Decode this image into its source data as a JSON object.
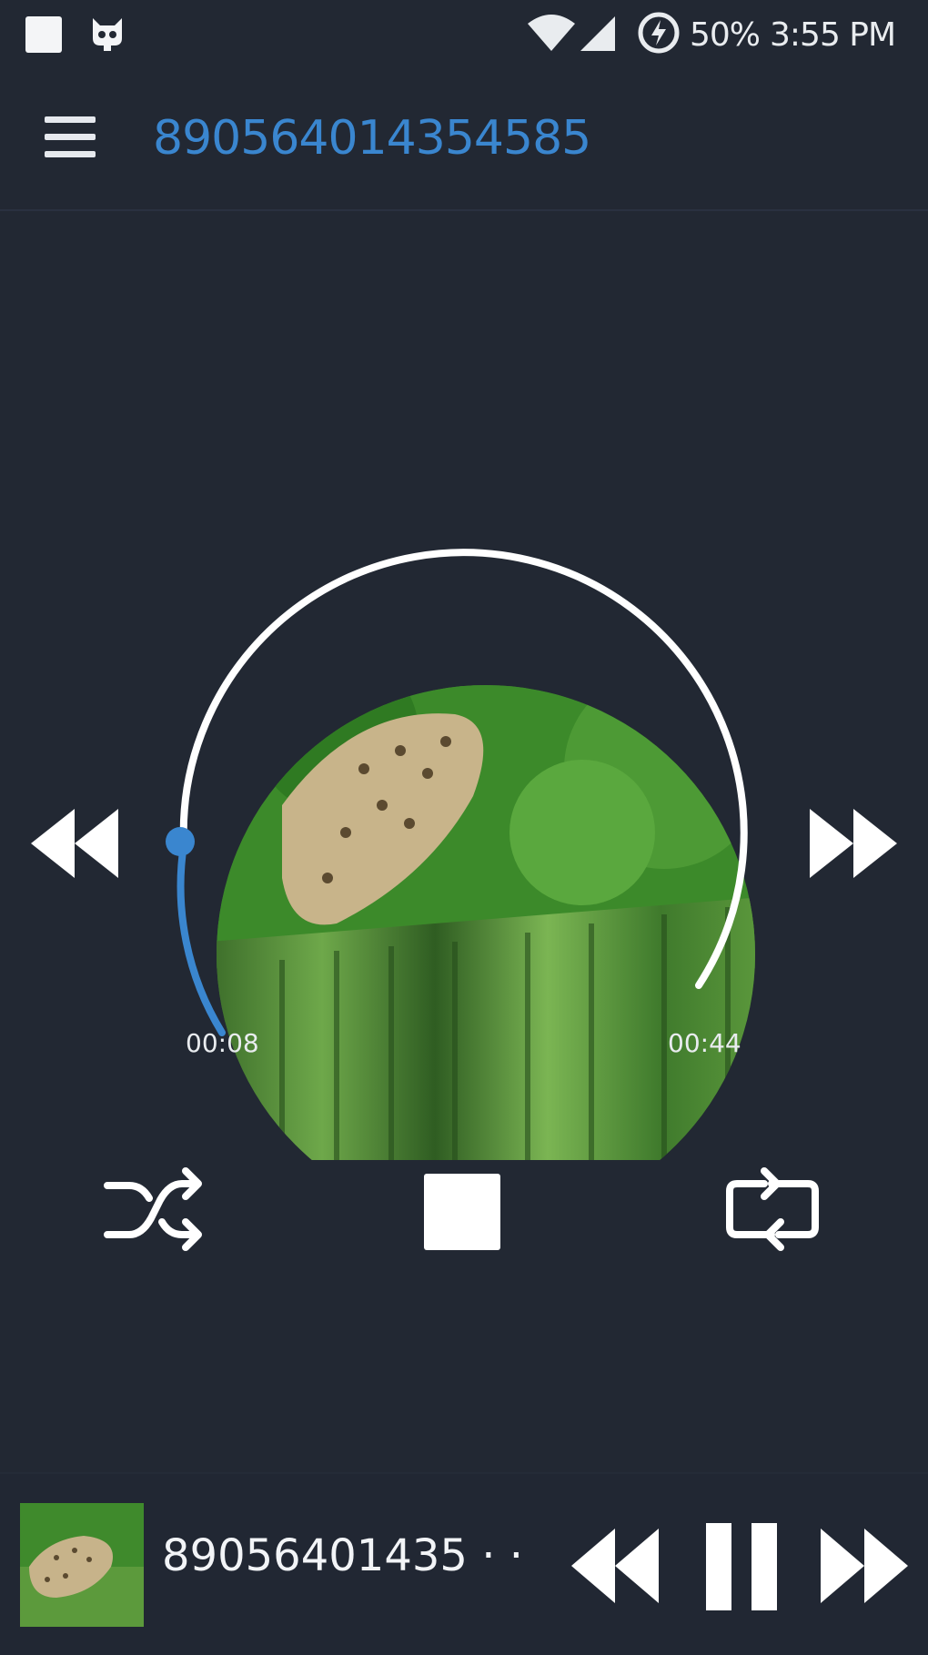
{
  "status_bar": {
    "battery": "50%",
    "time": "3:55 PM",
    "icons": [
      "stop-square-icon",
      "android-cat-icon",
      "wifi-icon",
      "signal-icon",
      "battery-charging-icon"
    ]
  },
  "app_bar": {
    "title": "89056401435458​5"
  },
  "player": {
    "elapsed": "00:08",
    "duration": "00:44",
    "progress": 0.18,
    "accent_color": "#3a86cf",
    "artwork": "leopard-in-grass-artwork"
  },
  "controls": [
    "shuffle-icon",
    "stop-icon",
    "repeat-icon"
  ],
  "mini_player": {
    "title": "89056401435 · ·",
    "controls": [
      "rewind-icon",
      "pause-icon",
      "fast-forward-icon"
    ]
  }
}
